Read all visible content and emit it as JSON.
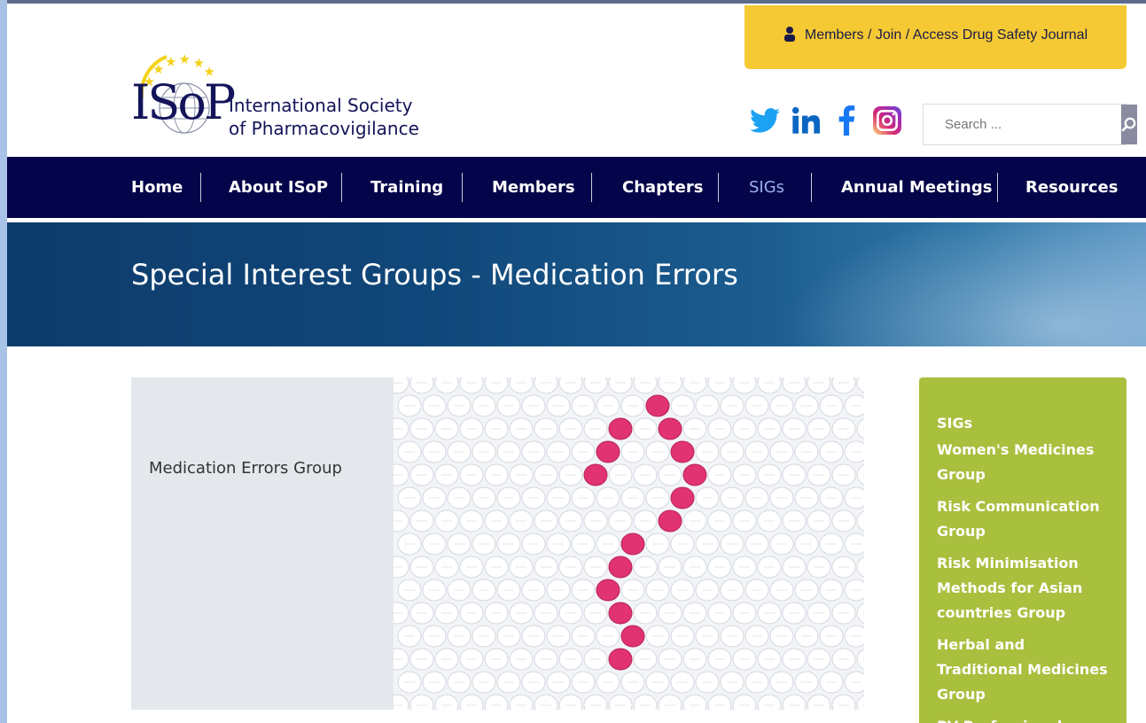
{
  "header": {
    "members_link": "Members / Join / Access Drug Safety Journal",
    "logo_line1": "International Society",
    "logo_line2": "of Pharmacovigilance",
    "logo_mark": "ISoP",
    "search_placeholder": "Search ..."
  },
  "social": [
    "twitter-icon",
    "linkedin-icon",
    "facebook-icon",
    "instagram-icon"
  ],
  "nav": {
    "items": [
      {
        "label": "Home"
      },
      {
        "label": "About ISoP"
      },
      {
        "label": "Training"
      },
      {
        "label": "Members"
      },
      {
        "label": "Chapters"
      },
      {
        "label": "SIGs",
        "active": true
      },
      {
        "label": "Annual Meetings"
      },
      {
        "label": "Resources"
      }
    ]
  },
  "hero": {
    "title": "Special Interest Groups - Medication Errors"
  },
  "card": {
    "label": "Medication Errors Group"
  },
  "sidebar": {
    "items": [
      "SIGs",
      "Women's Medicines Group",
      "Risk Communication Group",
      "Risk Minimisation Methods for Asian countries Group",
      "Herbal and Traditional Medicines Group",
      "PV Professional"
    ]
  },
  "colors": {
    "nav_bg": "#04044a",
    "members_bg": "#f5c933",
    "sidebar_bg": "#a9bf3e",
    "pill_pink": "#e0336f",
    "twitter": "#1da1f2",
    "linkedin": "#0a66c2",
    "facebook": "#1877f2"
  }
}
